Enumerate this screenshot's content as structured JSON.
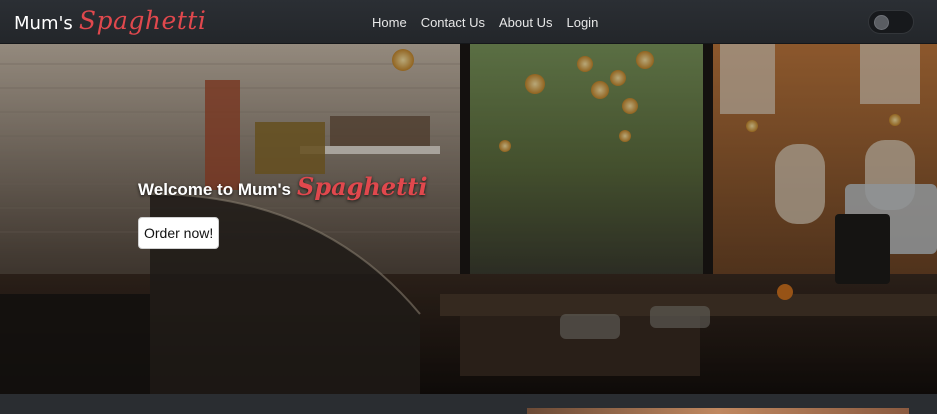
{
  "navbar": {
    "brand_plain": "Mum's",
    "brand_script": "Spaghetti",
    "links": [
      {
        "label": "Home"
      },
      {
        "label": "Contact Us"
      },
      {
        "label": "About Us"
      },
      {
        "label": "Login"
      }
    ],
    "theme_toggle": {
      "icon": "toggle-switch-icon",
      "state": "off"
    }
  },
  "hero": {
    "title_plain": "Welcome to Mum's",
    "title_script": "Spaghetti",
    "cta_label": "Order now!",
    "background_image": "cafe-interior-photo"
  },
  "colors": {
    "navbar_bg": "#23262a",
    "brand_accent": "#e0484d",
    "page_bg": "#2a2d31",
    "button_bg": "#ffffff"
  }
}
